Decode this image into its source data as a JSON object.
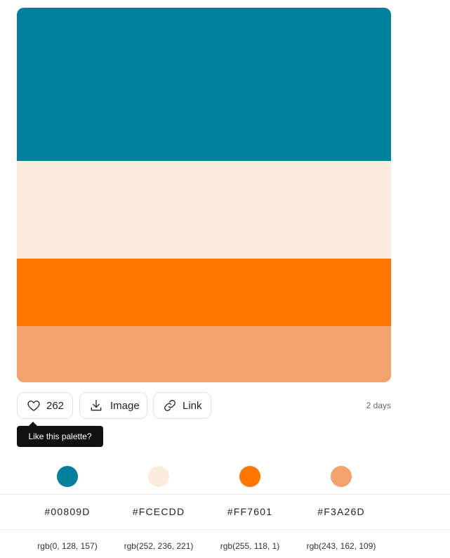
{
  "palette": {
    "colors": [
      {
        "hex": "#00809D",
        "rgb": "rgb(0, 128, 157)"
      },
      {
        "hex": "#FCECDD",
        "rgb": "rgb(252, 236, 221)"
      },
      {
        "hex": "#FF7601",
        "rgb": "rgb(255, 118, 1)"
      },
      {
        "hex": "#F3A26D",
        "rgb": "rgb(243, 162, 109)"
      }
    ]
  },
  "actions": {
    "like_count": "262",
    "image_label": "Image",
    "link_label": "Link",
    "like_icon": "heart-icon",
    "image_icon": "download-icon",
    "link_icon": "link-icon"
  },
  "meta": {
    "age": "2 days"
  },
  "tooltip": {
    "text": "Like this palette?"
  }
}
